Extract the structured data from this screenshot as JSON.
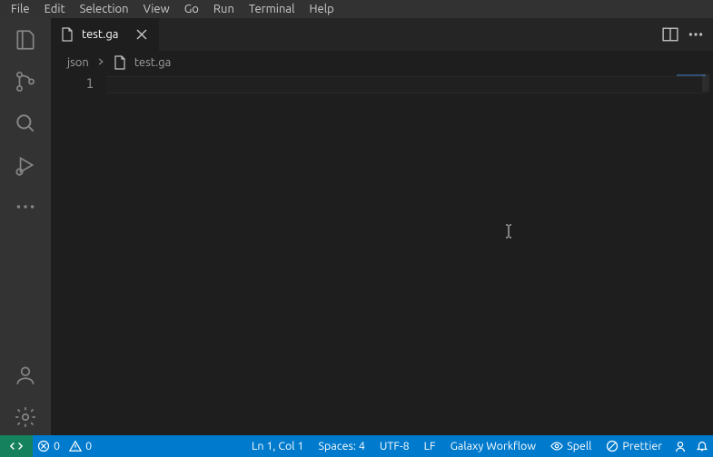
{
  "menubar": {
    "items": [
      "File",
      "Edit",
      "Selection",
      "View",
      "Go",
      "Run",
      "Terminal",
      "Help"
    ]
  },
  "tabs": {
    "active": {
      "label": "test.ga"
    }
  },
  "breadcrumb": {
    "folder": "json",
    "file": "test.ga"
  },
  "editor": {
    "line_number_1": "1"
  },
  "statusbar": {
    "errors": "0",
    "warnings": "0",
    "position": "Ln 1, Col 1",
    "indent": "Spaces: 4",
    "encoding": "UTF-8",
    "eol": "LF",
    "language": "Galaxy Workflow",
    "spell": "Spell",
    "prettier": "Prettier"
  }
}
